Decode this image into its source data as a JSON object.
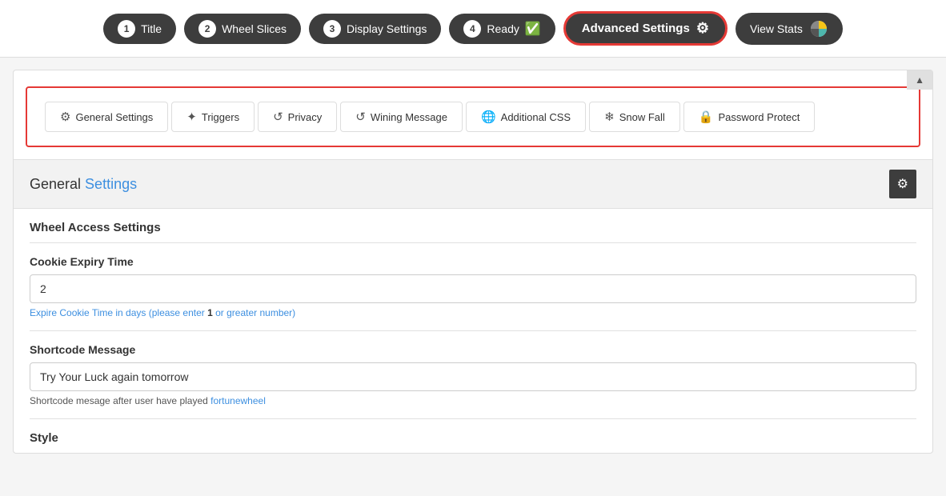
{
  "topNav": {
    "steps": [
      {
        "id": "title",
        "num": "1",
        "label": "Title",
        "hasCheck": false
      },
      {
        "id": "wheel-slices",
        "num": "2",
        "label": "Wheel Slices",
        "hasCheck": false
      },
      {
        "id": "display-settings",
        "num": "3",
        "label": "Display Settings",
        "hasCheck": false
      },
      {
        "id": "ready",
        "num": "4",
        "label": "Ready",
        "hasCheck": true
      }
    ],
    "advancedSettings": {
      "label": "Advanced Settings",
      "gearIcon": "⚙"
    },
    "viewStats": {
      "label": "View Stats"
    }
  },
  "tabNav": {
    "tabs": [
      {
        "id": "general-settings",
        "label": "General Settings",
        "icon": "⚙"
      },
      {
        "id": "triggers",
        "label": "Triggers",
        "icon": "✦"
      },
      {
        "id": "privacy",
        "label": "Privacy",
        "icon": "↺"
      },
      {
        "id": "wining-message",
        "label": "Wining Message",
        "icon": "↺"
      },
      {
        "id": "additional-css",
        "label": "Additional CSS",
        "icon": "🌐"
      },
      {
        "id": "snow-fall",
        "label": "Snow Fall",
        "icon": "❄"
      },
      {
        "id": "password-protect",
        "label": "Password Protect",
        "icon": "🔒"
      }
    ]
  },
  "sectionHeading": {
    "titlePrefix": "General",
    "titleSuffix": " Settings"
  },
  "formSections": {
    "wheelAccessTitle": "Wheel Access Settings",
    "cookieLabel": "Cookie Expiry Time",
    "cookieValue": "2",
    "cookiePlaceholder": "2",
    "cookieHintPrefix": "Expire Cookie Time in days (please enter ",
    "cookieHintNum": "1",
    "cookieHintSuffix": " or greater number)",
    "shortcodeLabel": "Shortcode Message",
    "shortcodeValue": "Try Your Luck again tomorrow",
    "shortcodePlaceholder": "Try Your Luck again tomorrow",
    "shortcodeHintPrefix": "Shortcode mesage after user have played ",
    "shortcodeHintLink": "fortunewheel",
    "styleTitle": "Style"
  }
}
